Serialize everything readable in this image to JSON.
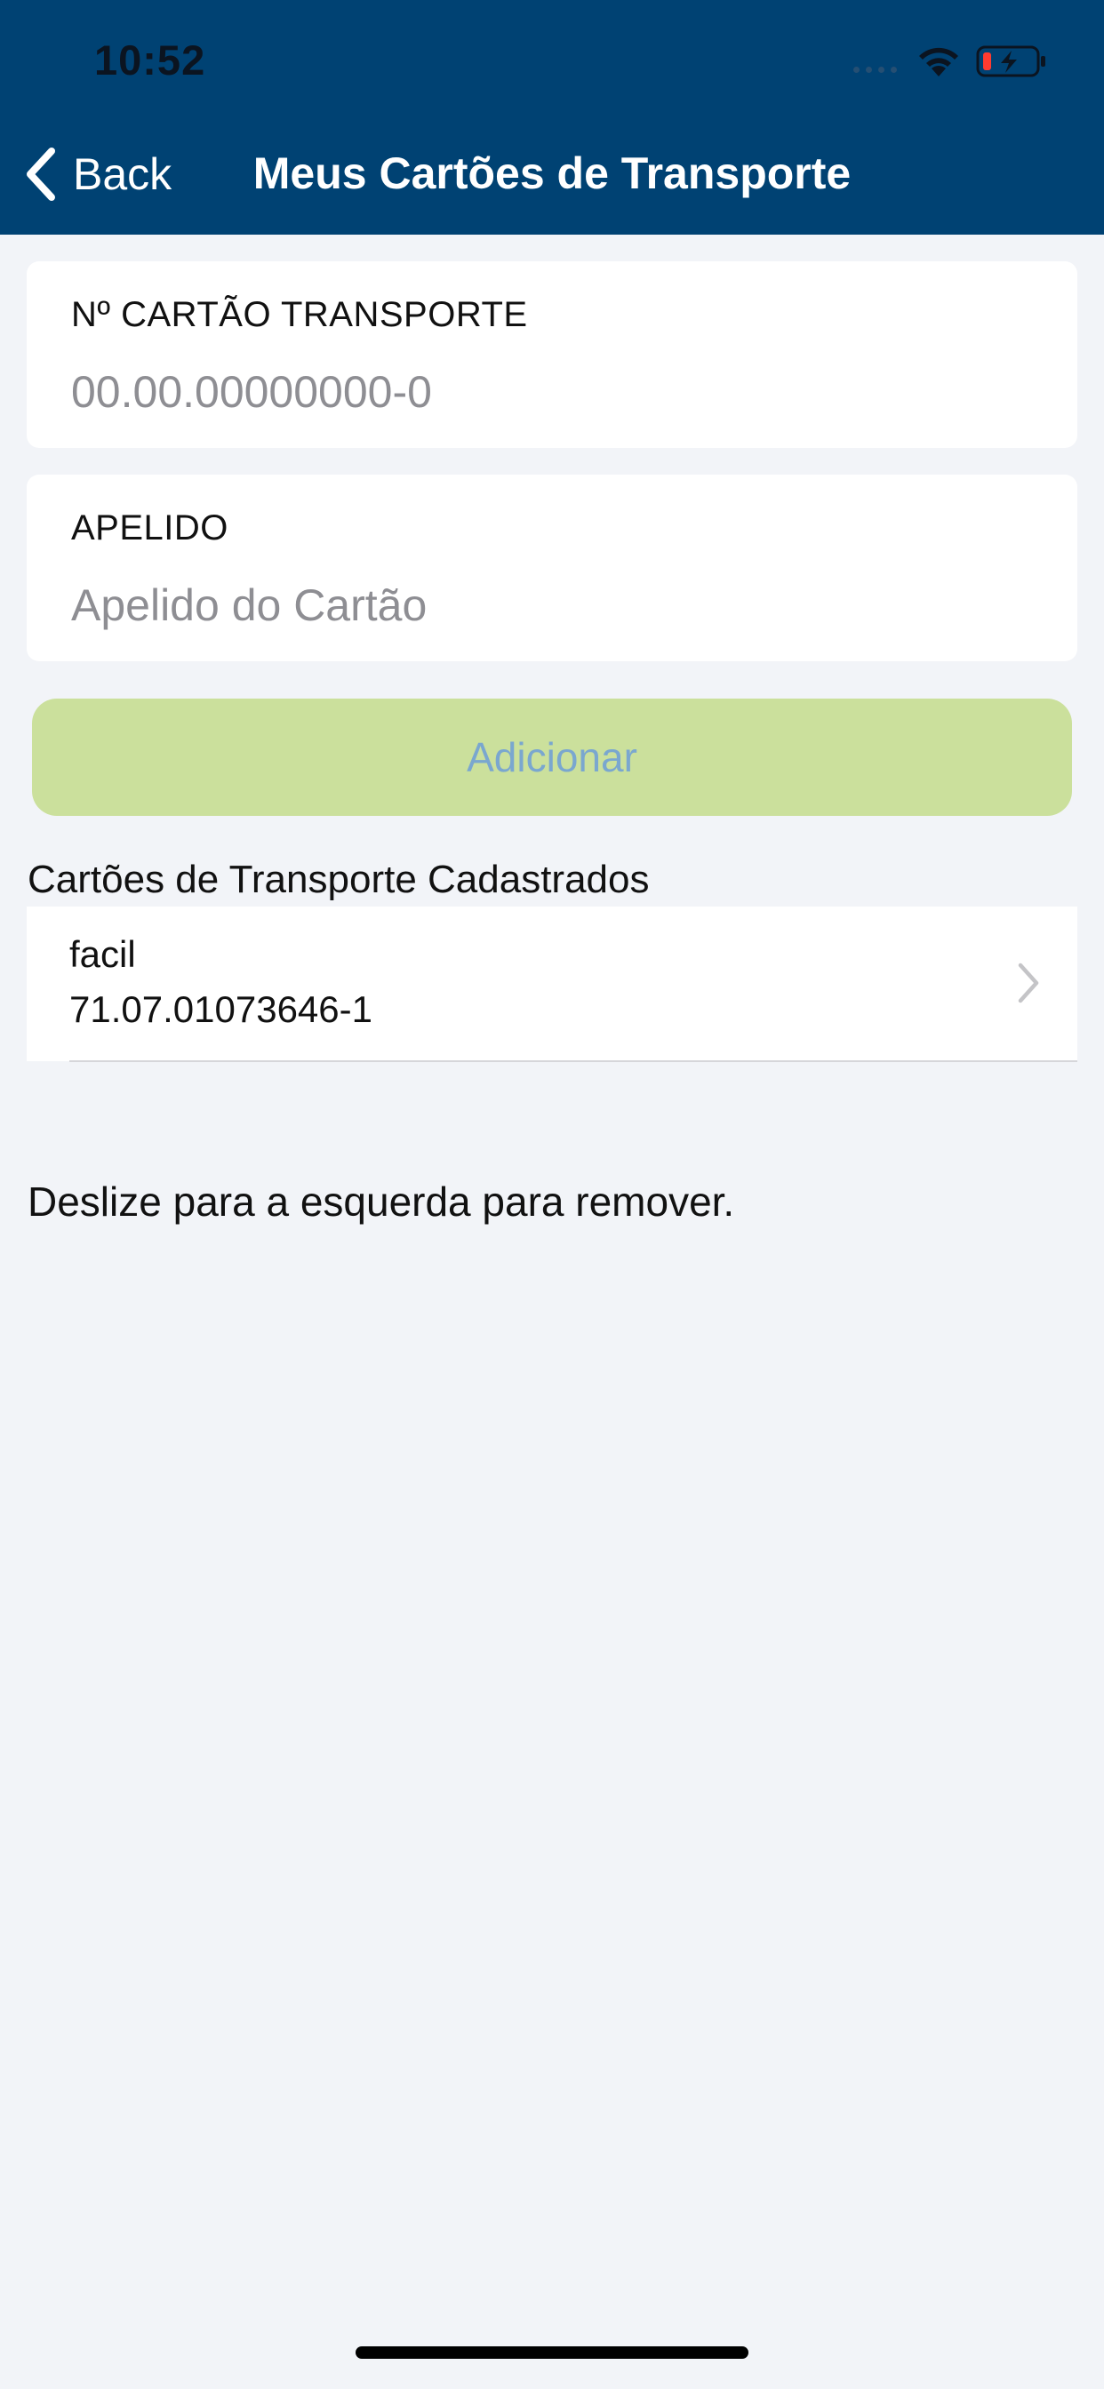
{
  "status_bar": {
    "time": "10:52"
  },
  "nav": {
    "back_label": "Back",
    "title": "Meus Cartões de Transporte"
  },
  "form": {
    "card_number": {
      "label": "Nº CARTÃO TRANSPORTE",
      "placeholder": "00.00.00000000-0",
      "value": ""
    },
    "nickname": {
      "label": "APELIDO",
      "placeholder": "Apelido do Cartão",
      "value": ""
    },
    "add_label": "Adicionar"
  },
  "registered": {
    "title": "Cartões de Transporte Cadastrados",
    "items": [
      {
        "name": "facil",
        "number": "71.07.01073646-1"
      }
    ]
  },
  "hint": "Deslize para a esquerda para remover.",
  "colors": {
    "header": "#004273",
    "background": "#f2f4f8",
    "add_button": "#cbe09c",
    "add_button_text": "#7aa7cf"
  }
}
